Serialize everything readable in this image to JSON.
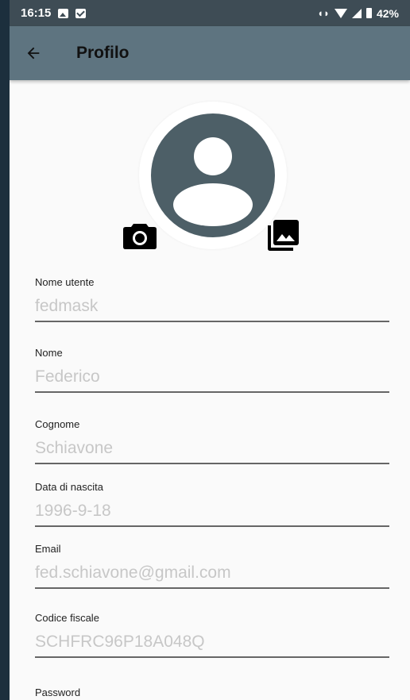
{
  "status_bar": {
    "time": "16:15",
    "battery": "42%"
  },
  "app_bar": {
    "title": "Profilo"
  },
  "fields": [
    {
      "label": "Nome utente",
      "value": "fedmask"
    },
    {
      "label": "Nome",
      "value": "Federico"
    },
    {
      "label": "Cognome",
      "value": "Schiavone"
    },
    {
      "label": "Data di nascita",
      "value": "1996-9-18"
    },
    {
      "label": "Email",
      "value": "fed.schiavone@gmail.com"
    },
    {
      "label": "Codice fiscale",
      "value": "SCHFRC96P18A048Q"
    }
  ],
  "password_label": "Password",
  "colors": {
    "app_bar": "#5e7480",
    "status_bar": "#3e4c55",
    "avatar": "#4d5f67"
  },
  "icons": [
    "back-arrow-icon",
    "account-circle-icon",
    "camera-icon",
    "photo-library-icon"
  ]
}
